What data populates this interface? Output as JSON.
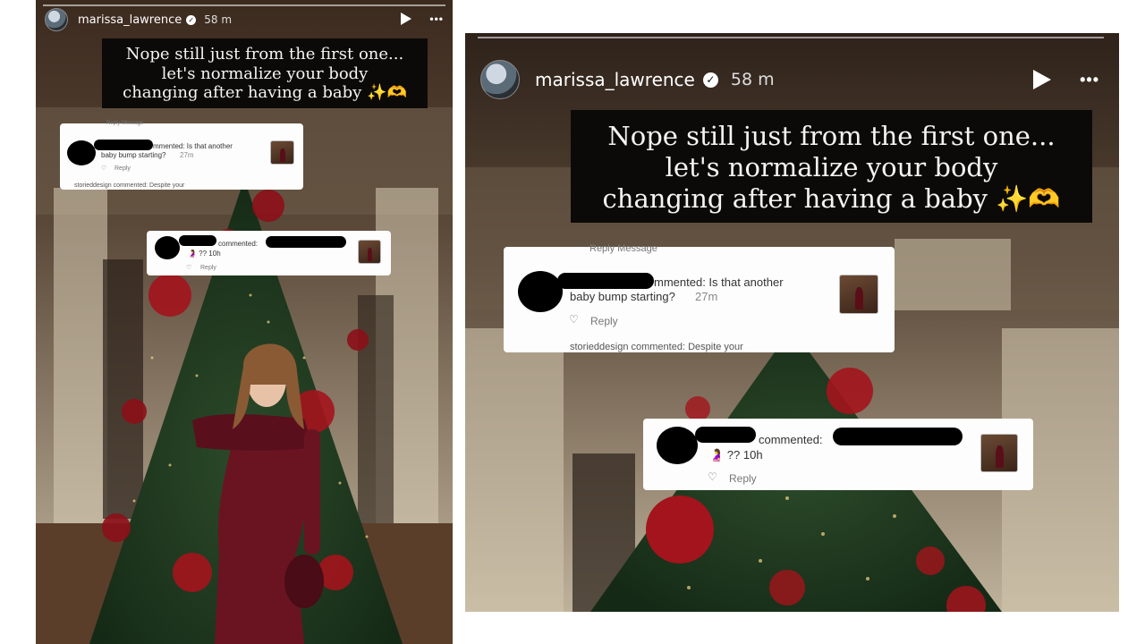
{
  "story": {
    "username": "marissa_lawrence",
    "verified_icon": "verified-check-icon",
    "time_ago": "58 m",
    "caption_lines": [
      "Nope still just from the first one...",
      "let's normalize your body",
      "changing after having a baby ✨🫶"
    ],
    "comment_1": {
      "text_line1": "mmented: Is that another",
      "text_line2": "baby bump starting?",
      "time": "27m",
      "reply": "Reply",
      "overlay_text": "Reply  Message"
    },
    "comment_2": {
      "text": "commented:",
      "subtext": "🤰 ?? 10h",
      "reply": "Reply"
    },
    "partial_comment_text": "storieddesign commented: Despite your",
    "controls": {
      "play": "play-icon",
      "more": "•••"
    }
  },
  "colors": {
    "caption_bg": "#0c0a08",
    "card_bg": "#fdfdfd",
    "dress": "#6a1422",
    "tree": "#1f3d22",
    "ornament": "#a3141c"
  }
}
